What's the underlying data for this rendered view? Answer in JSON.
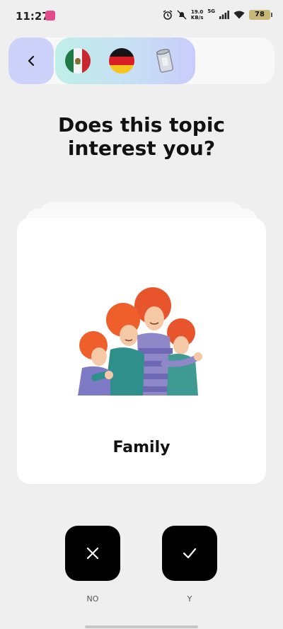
{
  "status": {
    "time": "11:27",
    "net_speed_value": "19.0",
    "net_speed_unit": "KB/s",
    "net_type": "5G",
    "battery": "78",
    "icons": [
      "alarm-icon",
      "mute-icon",
      "signal-icon",
      "wifi-icon",
      "battery-icon"
    ]
  },
  "topbar": {
    "back_icon": "chevron-left-icon",
    "flags": [
      "mexico-flag",
      "germany-flag",
      "can-icon"
    ]
  },
  "question": {
    "line1": "Does this topic",
    "line2": "interest you?"
  },
  "card": {
    "title": "Family",
    "image": "family-illustration"
  },
  "actions": {
    "no_label": "NO",
    "yes_label": "Y"
  },
  "colors": {
    "background": "#efefef",
    "back_button": "#cdd2fb",
    "button_dark": "#000000",
    "card": "#ffffff"
  }
}
